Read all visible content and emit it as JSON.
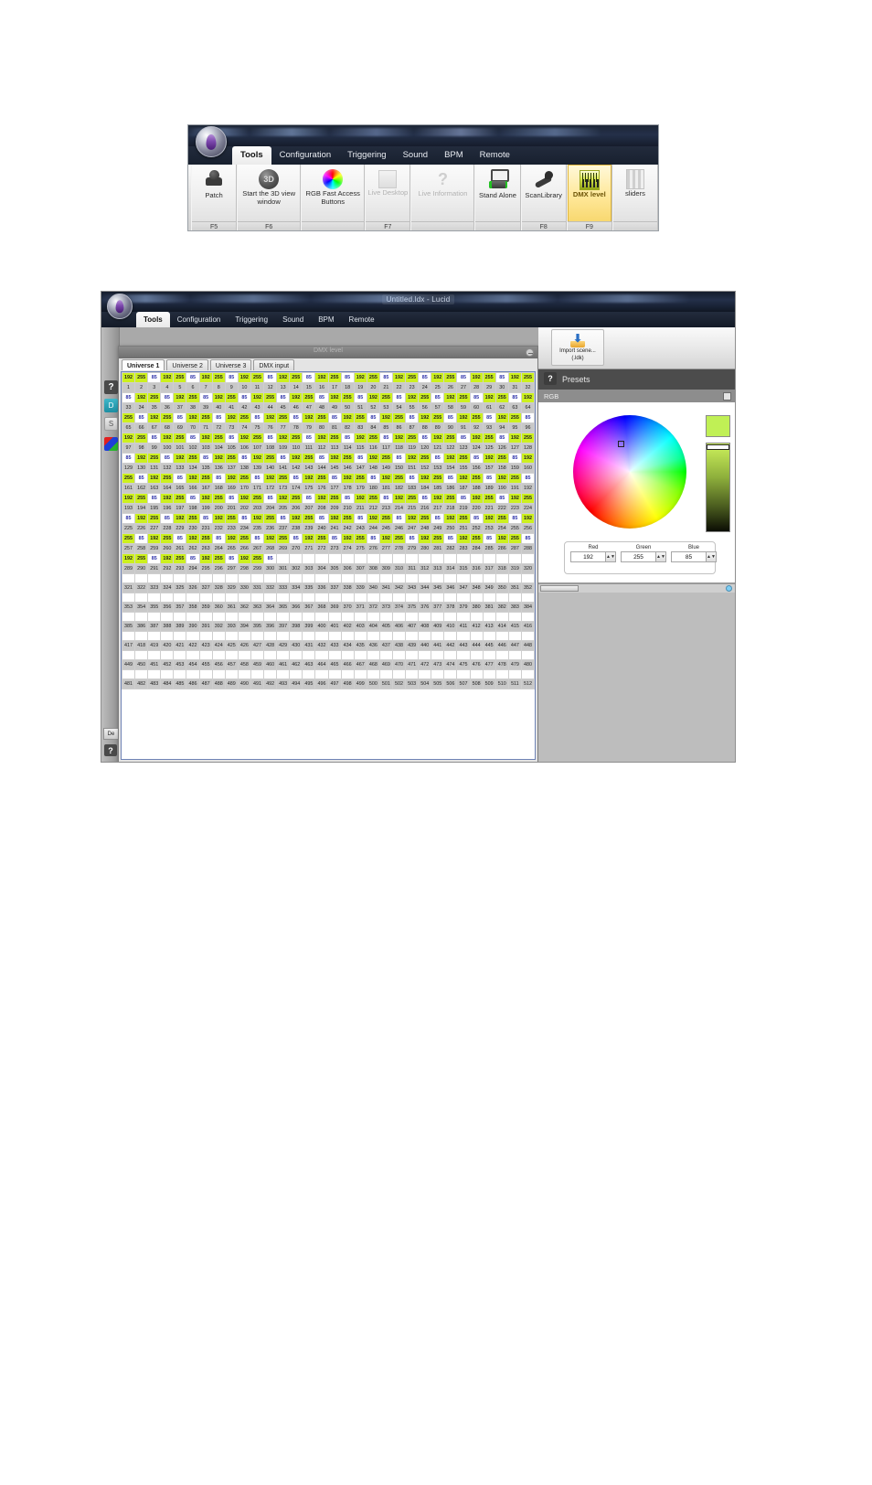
{
  "ribbon_window": {
    "menu": [
      {
        "label": "Tools",
        "active": true
      },
      {
        "label": "Configuration",
        "active": false
      },
      {
        "label": "Triggering",
        "active": false
      },
      {
        "label": "Sound",
        "active": false
      },
      {
        "label": "BPM",
        "active": false
      },
      {
        "label": "Remote",
        "active": false
      }
    ],
    "buttons": [
      {
        "label": "Patch",
        "fkey": "F5",
        "icon": "moving-head-icon",
        "state": "enabled",
        "selected": false
      },
      {
        "label": "Start the 3D view window",
        "fkey": "F6",
        "icon": "3d-sphere-icon",
        "state": "enabled",
        "selected": false
      },
      {
        "label": "RGB Fast Access Buttons",
        "fkey": "",
        "icon": "color-wheel-icon",
        "state": "enabled",
        "selected": false
      },
      {
        "label": "Live Desktop",
        "fkey": "F7",
        "icon": "live-desktop-icon",
        "state": "disabled",
        "selected": false
      },
      {
        "label": "Live Information",
        "fkey": "",
        "icon": "question-mark-icon",
        "state": "disabled",
        "selected": false
      },
      {
        "label": "Stand Alone",
        "fkey": "",
        "icon": "standalone-device-icon",
        "state": "enabled",
        "selected": false
      },
      {
        "label": "ScanLibrary",
        "fkey": "F8",
        "icon": "scanner-icon",
        "state": "enabled",
        "selected": false
      },
      {
        "label": "DMX level",
        "fkey": "F9",
        "icon": "dmx-level-icon",
        "state": "enabled",
        "selected": true
      },
      {
        "label": "sliders",
        "fkey": "",
        "icon": "sliders-icon",
        "state": "enabled",
        "selected": false
      }
    ]
  },
  "app_window": {
    "title": "Untitled.ldx - Lucid",
    "menu": [
      {
        "label": "Tools",
        "active": true
      },
      {
        "label": "Configuration",
        "active": false
      },
      {
        "label": "Triggering",
        "active": false
      },
      {
        "label": "Sound",
        "active": false
      },
      {
        "label": "BPM",
        "active": false
      },
      {
        "label": "Remote",
        "active": false
      }
    ],
    "left_rail": {
      "icons": [
        "question-icon",
        "cyan-dmx-icon",
        "grey-tool-icon",
        "rgb-palette-icon"
      ],
      "bottom_button_label": "De",
      "bottom_help_label": "?"
    },
    "dmx_dialog": {
      "title": "DMX level",
      "close_icon": "minimize-icon",
      "tabs": [
        {
          "label": "Universe 1",
          "active": true
        },
        {
          "label": "Universe 2",
          "active": false
        },
        {
          "label": "Universe 3",
          "active": false
        },
        {
          "label": "DMX input",
          "active": false
        }
      ],
      "grid": {
        "columns": 32,
        "total_channels": 512,
        "active_channels": 300,
        "value_pattern": [
          192,
          255,
          85
        ],
        "highlight_values": [
          192,
          255
        ],
        "highlight_color": "#ccf01e",
        "value_text_color": "#2b2fa8",
        "index_row_background": "#c8c8c8"
      }
    },
    "right_pane": {
      "toolbar": {
        "import_button": {
          "line1": "Import scene...",
          "line2": "(.ldk)",
          "icon": "import-folder-icon"
        }
      },
      "presets_header": {
        "label": "Presets",
        "help_icon": "question-icon"
      },
      "rgb_section": {
        "label": "RGB",
        "checkbox_icon": "checkbox-icon",
        "color_wheel_icon": "color-wheel-icon",
        "preview_color": "#c0f055",
        "luminance_slider_icon": "luminance-slider",
        "fields": [
          {
            "caption": "Red",
            "value": "192"
          },
          {
            "caption": "Green",
            "value": "255"
          },
          {
            "caption": "Blue",
            "value": "85"
          }
        ]
      },
      "scrollbar": {
        "thumb_icon": "scroll-thumb",
        "status_dot_icon": "status-dot-icon"
      }
    }
  }
}
